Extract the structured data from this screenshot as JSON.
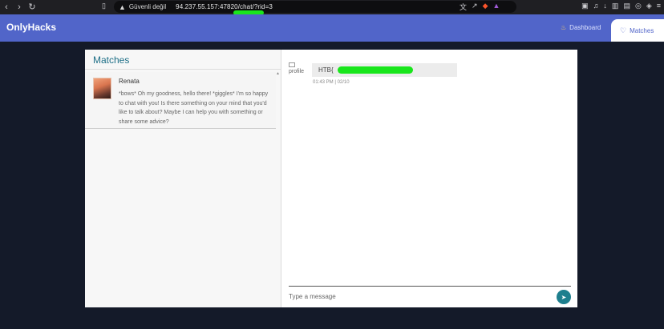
{
  "browser": {
    "security_label": "Güvenli değil",
    "url": "94.237.55.157:47820/chat/?rid=3"
  },
  "app": {
    "brand": "OnlyHacks",
    "nav": {
      "dashboard_label": "Dashboard",
      "matches_label": "Matches"
    }
  },
  "sidebar": {
    "title": "Matches",
    "contacts": [
      {
        "name": "Renata",
        "preview": "*bows* Oh my goodness, hello there! *giggles* I'm so happy to chat with you! Is there something on your mind that you'd like to talk about? Maybe I can help you with something or share some advice?"
      }
    ]
  },
  "chat": {
    "messages": [
      {
        "avatar_alt": "profile",
        "text": "HTB{",
        "time": "01:43 PM | 02/10"
      }
    ],
    "input_placeholder": "Type a message"
  },
  "colors": {
    "header": "#5165c9",
    "accent": "#1e7f8e",
    "title": "#1e6f87",
    "redaction": "#19e61c"
  }
}
